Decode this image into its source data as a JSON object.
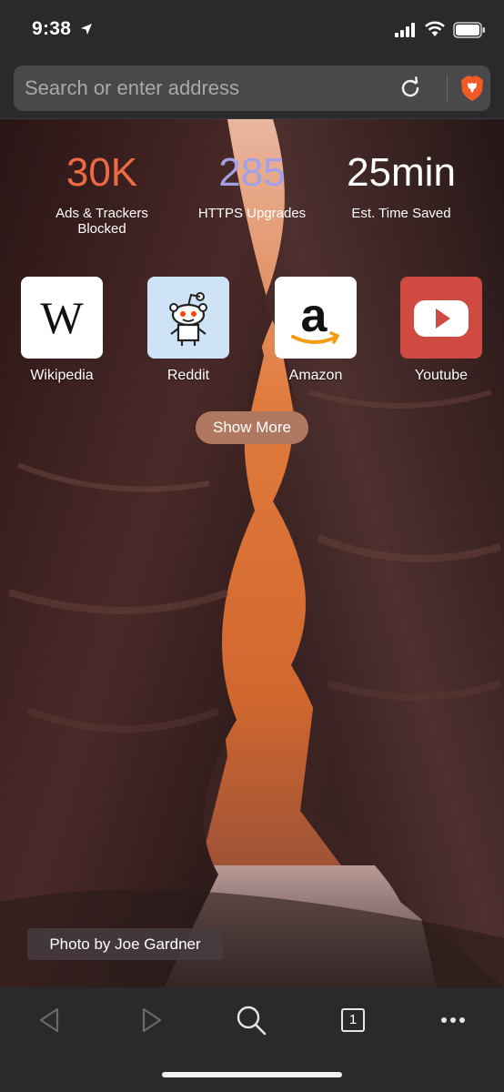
{
  "status": {
    "time": "9:38"
  },
  "address_bar": {
    "placeholder": "Search or enter address"
  },
  "stats": {
    "ads": {
      "value": "30K",
      "label": "Ads & Trackers Blocked",
      "color": "#ee6a44"
    },
    "https": {
      "value": "285",
      "label": "HTTPS Upgrades",
      "color": "#a3a0e8"
    },
    "time": {
      "value": "25min",
      "label": "Est. Time Saved",
      "color": "#ffffff"
    }
  },
  "favorites": [
    {
      "name": "Wikipedia",
      "icon": "wikipedia-icon"
    },
    {
      "name": "Reddit",
      "icon": "reddit-icon"
    },
    {
      "name": "Amazon",
      "icon": "amazon-icon"
    },
    {
      "name": "Youtube",
      "icon": "youtube-icon"
    }
  ],
  "show_more_label": "Show More",
  "photo_credit": "Photo by Joe Gardner",
  "toolbar": {
    "tab_count": "1"
  }
}
